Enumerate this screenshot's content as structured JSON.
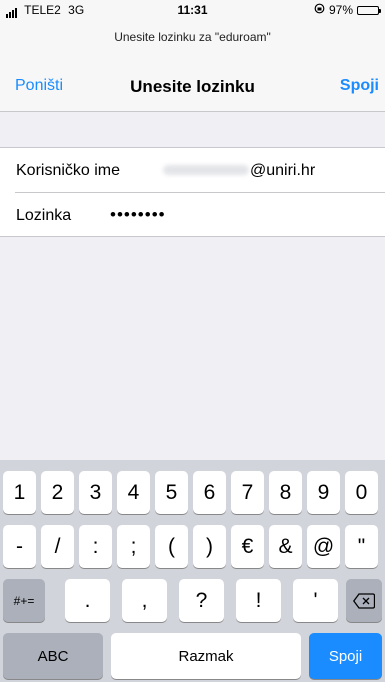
{
  "status_bar": {
    "carrier": "TELE2",
    "network": "3G",
    "time": "11:31",
    "battery_percent": "97%"
  },
  "dialog": {
    "prompt": "Unesite lozinku za \"eduroam\"",
    "title": "Unesite lozinku",
    "cancel_label": "Poništi",
    "join_label": "Spoji"
  },
  "form": {
    "username_label": "Korisničko ime",
    "username_domain": "@uniri.hr",
    "password_label": "Lozinka",
    "password_value": "••••••••"
  },
  "keyboard": {
    "row1": [
      "1",
      "2",
      "3",
      "4",
      "5",
      "6",
      "7",
      "8",
      "9",
      "0"
    ],
    "row2": [
      "-",
      "/",
      ":",
      ";",
      "(",
      ")",
      "€",
      "&",
      "@",
      "\""
    ],
    "row3_mode": "#+=",
    "row3": [
      ".",
      ",",
      "?",
      "!",
      "'"
    ],
    "abc_label": "ABC",
    "space_label": "Razmak",
    "return_label": "Spoji"
  },
  "colors": {
    "accent": "#1a8cff",
    "background": "#efeff4",
    "keyboard": "#d1d4da"
  }
}
